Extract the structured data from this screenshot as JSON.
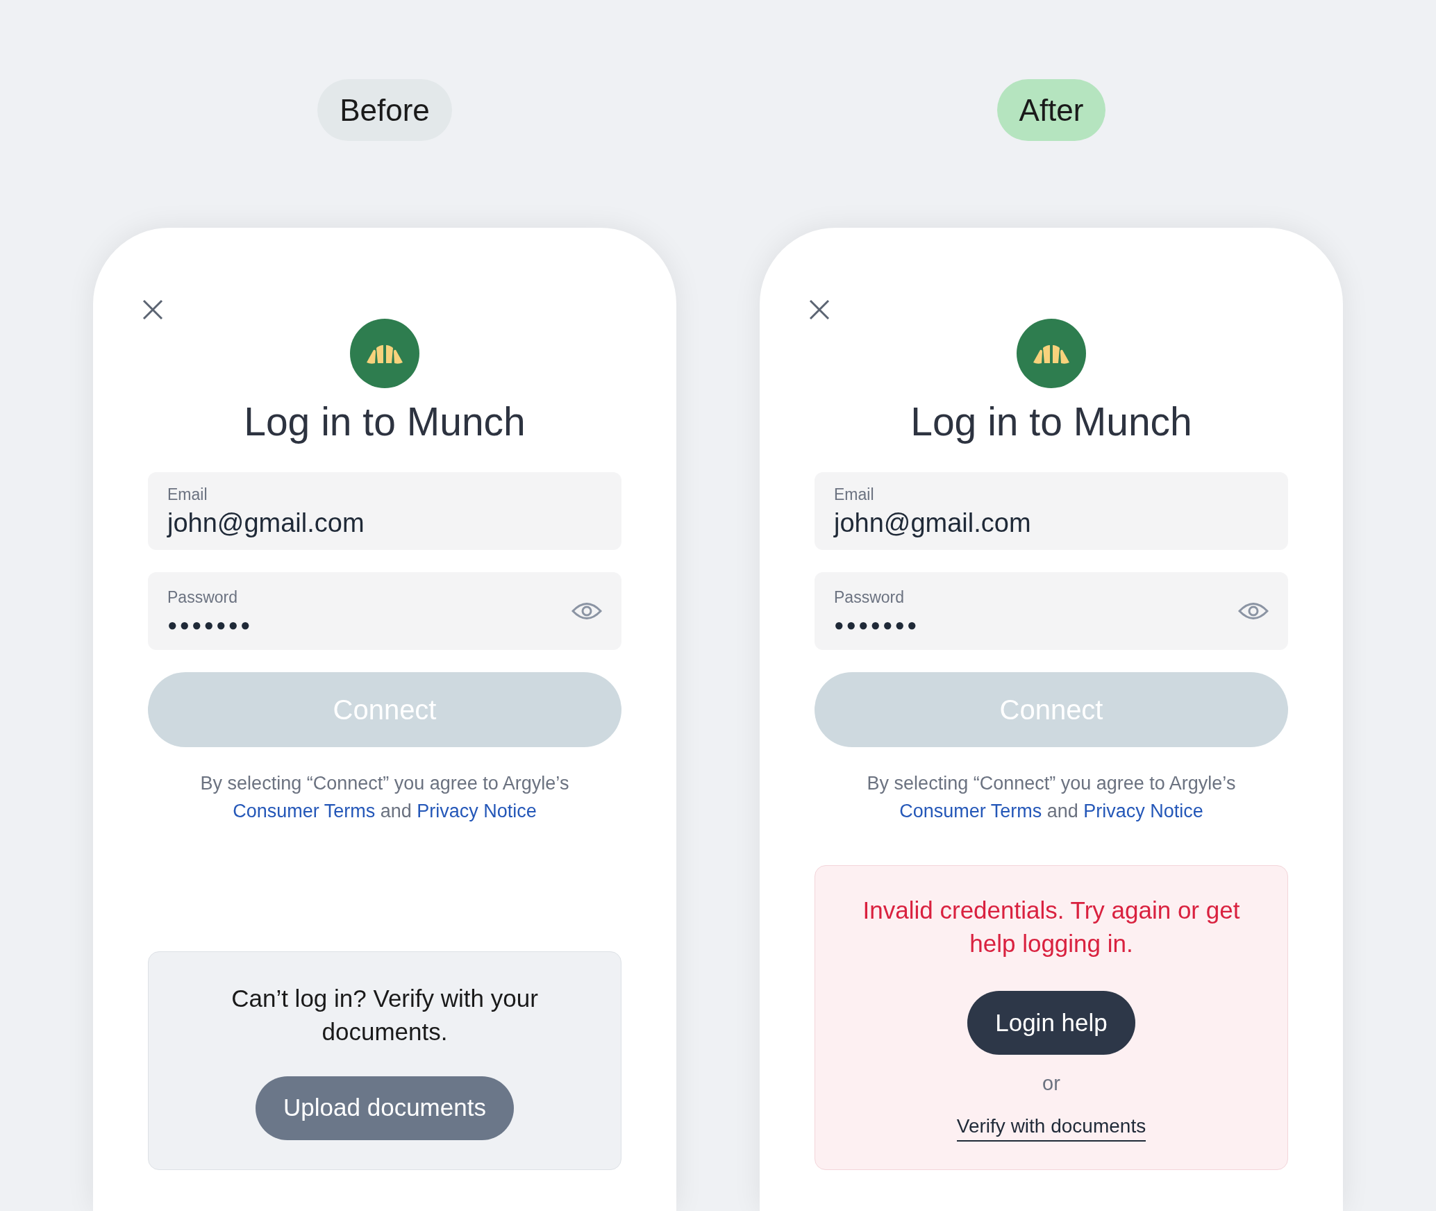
{
  "panels": [
    {
      "badge": {
        "label": "Before",
        "color": "#e3e8ea"
      },
      "title": "Log in to Munch",
      "fields": [
        {
          "kind": "text",
          "label": "Email",
          "value": "john@gmail.com"
        },
        {
          "kind": "password",
          "label": "Password",
          "value": "●●●●●●●"
        }
      ],
      "connect": {
        "label": "Connect",
        "disabled": true
      },
      "terms": {
        "text": "By selecting “Connect” you agree to Argyle’s",
        "link_1": "Consumer Terms",
        "joiner": "and",
        "link_2": "Privacy Notice"
      },
      "footer": {
        "kind": "verify",
        "message": "Can’t log in? Verify with your documents.",
        "button": "Upload documents"
      }
    },
    {
      "badge": {
        "label": "After",
        "color": "#b5e4bf"
      },
      "title": "Log in to Munch",
      "fields": [
        {
          "kind": "text",
          "label": "Email",
          "value": "john@gmail.com"
        },
        {
          "kind": "password",
          "label": "Password",
          "value": "●●●●●●●"
        }
      ],
      "connect": {
        "label": "Connect",
        "disabled": true
      },
      "terms": {
        "text": "By selecting “Connect” you agree to Argyle’s",
        "link_1": "Consumer Terms",
        "joiner": "and",
        "link_2": "Privacy Notice"
      },
      "footer": {
        "kind": "error",
        "message": "Invalid credentials. Try again or get help logging in.",
        "button": "Login help",
        "separator": "or",
        "link": "Verify with documents"
      }
    }
  ]
}
